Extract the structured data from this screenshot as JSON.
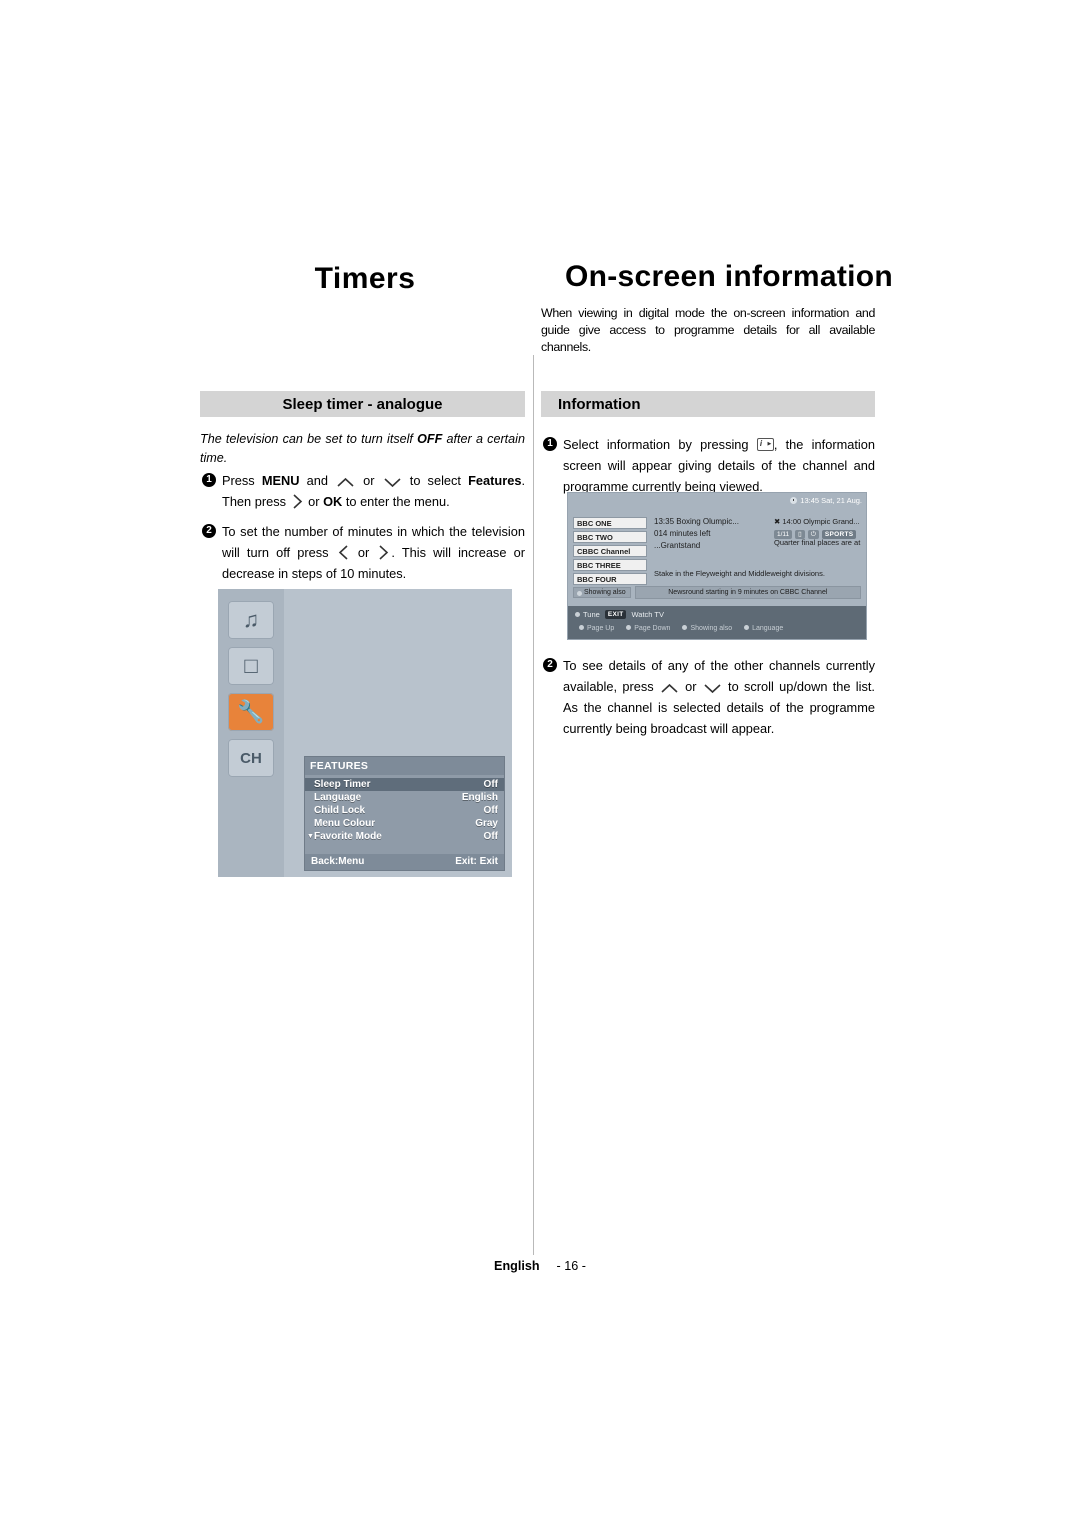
{
  "headings": {
    "left_title": "Timers",
    "right_title": "On-screen information",
    "intro": "When viewing in digital mode the on-screen information and guide give access to programme details for all available channels."
  },
  "left_section": {
    "bar_label": "Sleep timer - analogue",
    "italic_intro_a": "The television can be set to turn itself ",
    "italic_intro_off": "OFF",
    "italic_intro_b": " after a certain time.",
    "step1": {
      "num": "1",
      "t1": "Press ",
      "menu": "MENU",
      "t2": " and ",
      "t3": " or ",
      "t4": " to select ",
      "features": "Features",
      "t5": ". Then press ",
      "t6": " or ",
      "ok": "OK",
      "t7": " to enter the menu."
    },
    "step2": {
      "num": "2",
      "t1": "To set the number of minutes in which the television will turn off press ",
      "t2": " or ",
      "t3": ". This will increase or decrease in steps of 10 minutes."
    }
  },
  "tv_menu": {
    "icons": [
      "music-note-icon",
      "picture-icon",
      "wrench-icon",
      "channel-icon"
    ],
    "title": "FEATURES",
    "rows": [
      {
        "label": "Sleep Timer",
        "value": "Off",
        "highlighted": true
      },
      {
        "label": "Language",
        "value": "English",
        "highlighted": false
      },
      {
        "label": "Child Lock",
        "value": "Off",
        "highlighted": false
      },
      {
        "label": "Menu Colour",
        "value": "Gray",
        "highlighted": false
      },
      {
        "label": "Favorite Mode",
        "value": "Off",
        "highlighted": false
      }
    ],
    "footer_left": "Back:Menu",
    "footer_right": "Exit: Exit"
  },
  "right_section": {
    "bar_label": "Information",
    "step1": {
      "num": "1",
      "t1": "Select information by pressing ",
      "t2": ", the information screen will appear giving details of the channel and programme currently being viewed."
    },
    "step2": {
      "num": "2",
      "text": "To see details of any of the other channels currently available, press ",
      "t2": " or ",
      "t3": " to scroll up/down the list. As the channel is selected details of the programme currently being broadcast will appear."
    }
  },
  "osd": {
    "clock": "13:45 Sat, 21 Aug.",
    "channels": [
      "BBC ONE",
      "BBC TWO",
      "CBBC Channel",
      "BBC THREE",
      "BBC FOUR"
    ],
    "programme_now": "13:35 Boxing Olumpic...",
    "time_left": "014 minutes left",
    "programme_prev": "...Grantstand",
    "next_title": "14:00 Olympic Grand...",
    "badge_ratio": "1/11",
    "badge_sports": "SPORTS",
    "quarter_text": "Quarter final places are at",
    "stake_text": "Stake in the Fleyweight and Middleweight divisions.",
    "showing_label": "Showing also",
    "showing_text": "Newsround starting in 9 minutes on CBBC Channel",
    "foot_tune": "Tune",
    "foot_exit": "EXIT",
    "foot_watch": "Watch TV",
    "foot_pageup": "Page Up",
    "foot_pagedown": "Page Down",
    "foot_showing": "Showing also",
    "foot_language": "Language"
  },
  "footer": {
    "language": "English",
    "page": "- 16 -"
  }
}
